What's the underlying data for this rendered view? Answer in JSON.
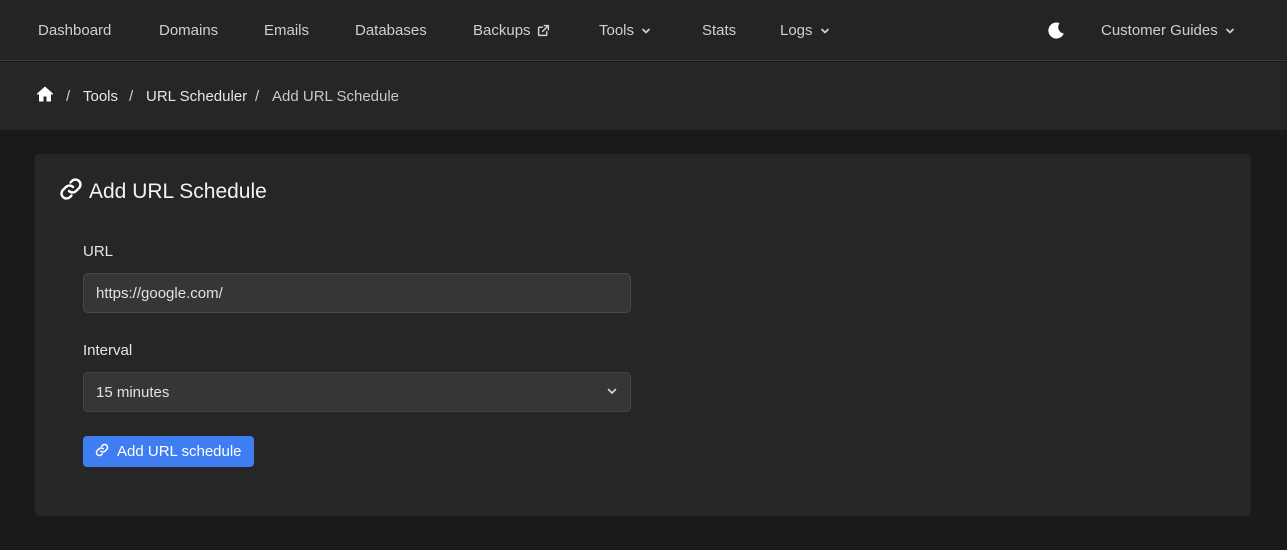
{
  "nav": {
    "items": [
      {
        "label": "Dashboard"
      },
      {
        "label": "Domains"
      },
      {
        "label": "Emails"
      },
      {
        "label": "Databases"
      },
      {
        "label": "Backups"
      },
      {
        "label": "Tools"
      },
      {
        "label": "Stats"
      },
      {
        "label": "Logs"
      }
    ],
    "theme_icon": "moon-icon",
    "guides_label": "Customer Guides"
  },
  "breadcrumb": {
    "home_icon": "home-icon",
    "items": [
      "Tools",
      "URL Scheduler",
      "Add URL Schedule"
    ],
    "separator": "/"
  },
  "form": {
    "title": "Add URL Schedule",
    "title_icon": "link-icon",
    "url_label": "URL",
    "url_value": "https://google.com/",
    "interval_label": "Interval",
    "interval_value": "15 minutes",
    "submit_label": "Add URL schedule",
    "submit_icon": "link-icon"
  },
  "colors": {
    "background": "#1a1a1a",
    "nav_background": "#242424",
    "card_background": "#262626",
    "accent": "#3f7ef2"
  }
}
